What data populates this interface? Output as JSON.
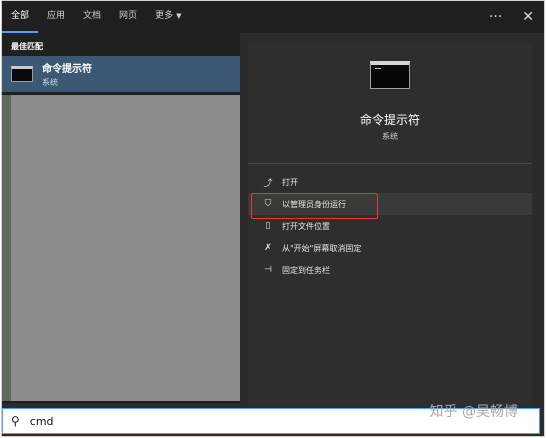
{
  "tabs": [
    {
      "label": "全部",
      "active": true
    },
    {
      "label": "应用",
      "active": false
    },
    {
      "label": "文档",
      "active": false
    },
    {
      "label": "网页",
      "active": false
    },
    {
      "label": "更多",
      "active": false
    }
  ],
  "top_actions": {
    "more": "···",
    "close": "✕"
  },
  "left": {
    "section_title": "最佳匹配",
    "result": {
      "name": "命令提示符",
      "subtitle": "系统"
    }
  },
  "right": {
    "title": "命令提示符",
    "subtitle": "系统",
    "menu": [
      {
        "label": "打开",
        "icon": "open-icon",
        "glyph": "⤴"
      },
      {
        "label": "以管理员身份运行",
        "icon": "admin-icon",
        "glyph": "⛉"
      },
      {
        "label": "打开文件位置",
        "icon": "file-location-icon",
        "glyph": "▯"
      },
      {
        "label": "从\"开始\"屏幕取消固定",
        "icon": "unpin-icon",
        "glyph": "✗"
      },
      {
        "label": "固定到任务栏",
        "icon": "pin-taskbar-icon",
        "glyph": "⊣"
      }
    ]
  },
  "search": {
    "value": "cmd"
  },
  "watermark": "知乎 @吴畅博",
  "colors": {
    "accent": "#4aa3ff",
    "selected": "#3b5874",
    "highlight_box": "#e53935"
  }
}
